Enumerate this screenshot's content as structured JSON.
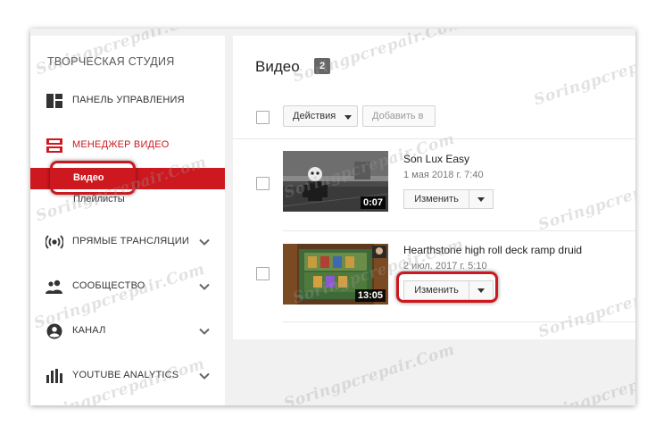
{
  "sidebar": {
    "studio_title": "ТВОРЧЕСКАЯ СТУДИЯ",
    "items": [
      {
        "label": "ПАНЕЛЬ УПРАВЛЕНИЯ",
        "icon": "dashboard-icon"
      },
      {
        "label": "МЕНЕДЖЕР ВИДЕО",
        "icon": "video-manager-icon",
        "active": true
      },
      {
        "label": "ПРЯМЫЕ ТРАНСЛЯЦИИ",
        "icon": "live-icon",
        "expandable": true
      },
      {
        "label": "СООБЩЕСТВО",
        "icon": "community-icon",
        "expandable": true
      },
      {
        "label": "КАНАЛ",
        "icon": "channel-icon",
        "expandable": true
      },
      {
        "label": "YOUTUBE ANALYTICS",
        "icon": "analytics-icon",
        "expandable": true
      }
    ],
    "subitems": [
      {
        "label": "Видео",
        "active": true
      },
      {
        "label": "Плейлисты"
      }
    ]
  },
  "main": {
    "title": "Видео",
    "count": "2",
    "toolbar": {
      "actions_label": "Действия",
      "add_to_label": "Добавить в"
    },
    "videos": [
      {
        "title": "Son Lux Easy",
        "date": "1 мая 2018 г. 7:40",
        "duration": "0:07",
        "edit_label": "Изменить"
      },
      {
        "title": "Hearthstone high roll deck ramp druid",
        "date": "2 июл. 2017 г. 5:10",
        "duration": "13:05",
        "edit_label": "Изменить"
      }
    ]
  },
  "watermark": "Soringpcrepair.Com",
  "colors": {
    "accent": "#cc181e",
    "badge": "#666666",
    "sidebar_bg": "#ffffff",
    "page_bg": "#f1f1f1"
  }
}
